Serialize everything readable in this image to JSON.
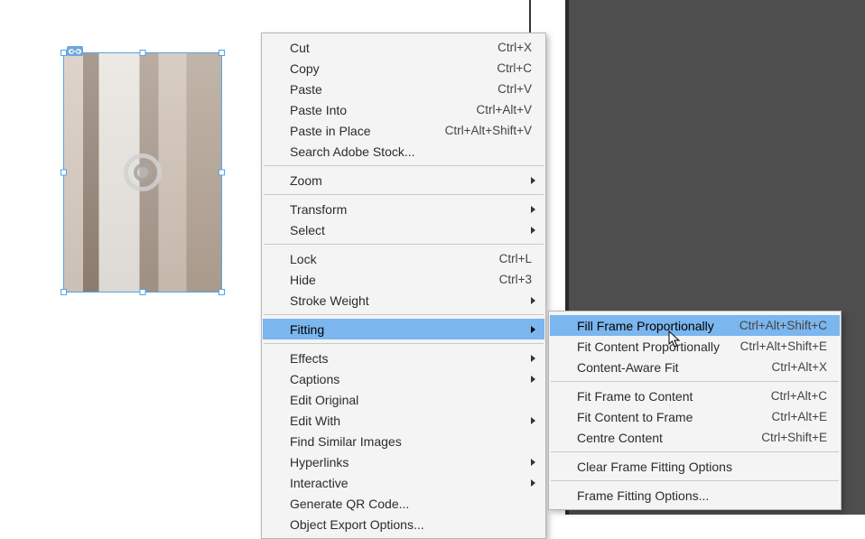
{
  "menu": {
    "groups": [
      [
        {
          "label": "Cut",
          "shortcut": "Ctrl+X"
        },
        {
          "label": "Copy",
          "shortcut": "Ctrl+C"
        },
        {
          "label": "Paste",
          "shortcut": "Ctrl+V"
        },
        {
          "label": "Paste Into",
          "shortcut": "Ctrl+Alt+V"
        },
        {
          "label": "Paste in Place",
          "shortcut": "Ctrl+Alt+Shift+V"
        },
        {
          "label": "Search Adobe Stock..."
        }
      ],
      [
        {
          "label": "Zoom",
          "submenu": true
        }
      ],
      [
        {
          "label": "Transform",
          "submenu": true
        },
        {
          "label": "Select",
          "submenu": true
        }
      ],
      [
        {
          "label": "Lock",
          "shortcut": "Ctrl+L"
        },
        {
          "label": "Hide",
          "shortcut": "Ctrl+3"
        },
        {
          "label": "Stroke Weight",
          "submenu": true
        }
      ],
      [
        {
          "label": "Fitting",
          "submenu": true,
          "highlight": true
        }
      ],
      [
        {
          "label": "Effects",
          "submenu": true
        },
        {
          "label": "Captions",
          "submenu": true
        },
        {
          "label": "Edit Original"
        },
        {
          "label": "Edit With",
          "submenu": true
        },
        {
          "label": "Find Similar Images"
        },
        {
          "label": "Hyperlinks",
          "submenu": true
        },
        {
          "label": "Interactive",
          "submenu": true
        },
        {
          "label": "Generate QR Code..."
        },
        {
          "label": "Object Export Options..."
        }
      ]
    ]
  },
  "submenu": {
    "groups": [
      [
        {
          "label": "Fill Frame Proportionally",
          "shortcut": "Ctrl+Alt+Shift+C",
          "highlight": true
        },
        {
          "label": "Fit Content Proportionally",
          "shortcut": "Ctrl+Alt+Shift+E"
        },
        {
          "label": "Content-Aware Fit",
          "shortcut": "Ctrl+Alt+X"
        }
      ],
      [
        {
          "label": "Fit Frame to Content",
          "shortcut": "Ctrl+Alt+C"
        },
        {
          "label": "Fit Content to Frame",
          "shortcut": "Ctrl+Alt+E"
        },
        {
          "label": "Centre Content",
          "shortcut": "Ctrl+Shift+E"
        }
      ],
      [
        {
          "label": "Clear Frame Fitting Options"
        }
      ],
      [
        {
          "label": "Frame Fitting Options..."
        }
      ]
    ]
  }
}
